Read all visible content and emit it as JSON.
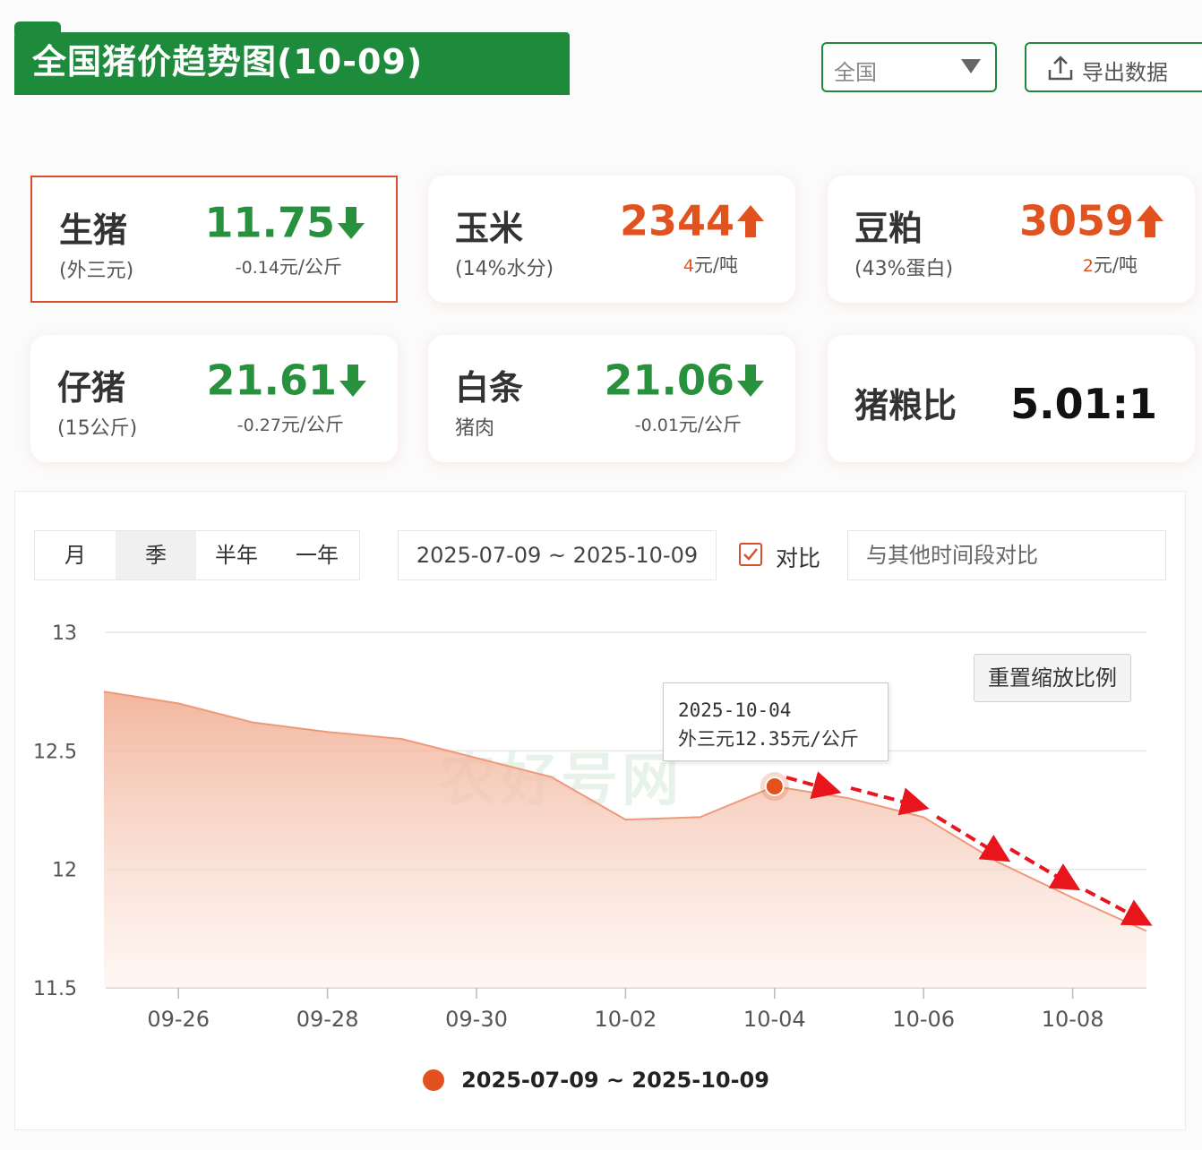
{
  "header": {
    "title": "全国猪价趋势图(10-09)",
    "region_select": "全国",
    "export_label": "导出数据"
  },
  "cards": [
    {
      "name": "生猪",
      "sub": "(外三元)",
      "price": "11.75",
      "direction": "down",
      "change": "-0.14",
      "unit": "元/公斤"
    },
    {
      "name": "玉米",
      "sub": "(14%水分)",
      "price": "2344",
      "direction": "up",
      "change": "4",
      "unit": "元/吨"
    },
    {
      "name": "豆粕",
      "sub": "(43%蛋白)",
      "price": "3059",
      "direction": "up",
      "change": "2",
      "unit": "元/吨"
    },
    {
      "name": "仔猪",
      "sub": "(15公斤)",
      "price": "21.61",
      "direction": "down",
      "change": "-0.27",
      "unit": "元/公斤"
    },
    {
      "name": "白条",
      "sub": "猪肉",
      "price": "21.06",
      "direction": "down",
      "change": "-0.01",
      "unit": "元/公斤"
    },
    {
      "name": "猪粮比",
      "ratio": "5.01:1"
    }
  ],
  "controls": {
    "range_tabs": [
      "月",
      "季",
      "半年",
      "一年"
    ],
    "active_tab": "季",
    "date_range": "2025-07-09 ~ 2025-10-09",
    "compare_label": "对比",
    "compare_checked": true,
    "compare_placeholder": "与其他时间段对比",
    "reset_zoom": "重置缩放比例"
  },
  "tooltip": {
    "date": "2025-10-04",
    "text": "外三元12.35元/公斤"
  },
  "watermark": "农好号网",
  "chart_data": {
    "type": "area",
    "series": [
      {
        "name": "2025-07-09 ~ 2025-10-09",
        "color": "#e2521f",
        "x": [
          "09-25",
          "09-26",
          "09-27",
          "09-28",
          "09-29",
          "09-30",
          "10-01",
          "10-02",
          "10-03",
          "10-04",
          "10-05",
          "10-06",
          "10-07",
          "10-08",
          "10-09"
        ],
        "values": [
          12.75,
          12.7,
          12.62,
          12.58,
          12.55,
          12.47,
          12.39,
          12.21,
          12.22,
          12.35,
          12.3,
          12.22,
          12.03,
          11.88,
          11.74
        ]
      }
    ],
    "xticks": [
      "09-26",
      "09-28",
      "09-30",
      "10-02",
      "10-04",
      "10-06",
      "10-08"
    ],
    "yticks": [
      "13",
      "12.5",
      "12",
      "11.5"
    ],
    "ylim": [
      11.5,
      13
    ],
    "highlight_index": 9,
    "grid": true,
    "legend_position": "bottom"
  }
}
